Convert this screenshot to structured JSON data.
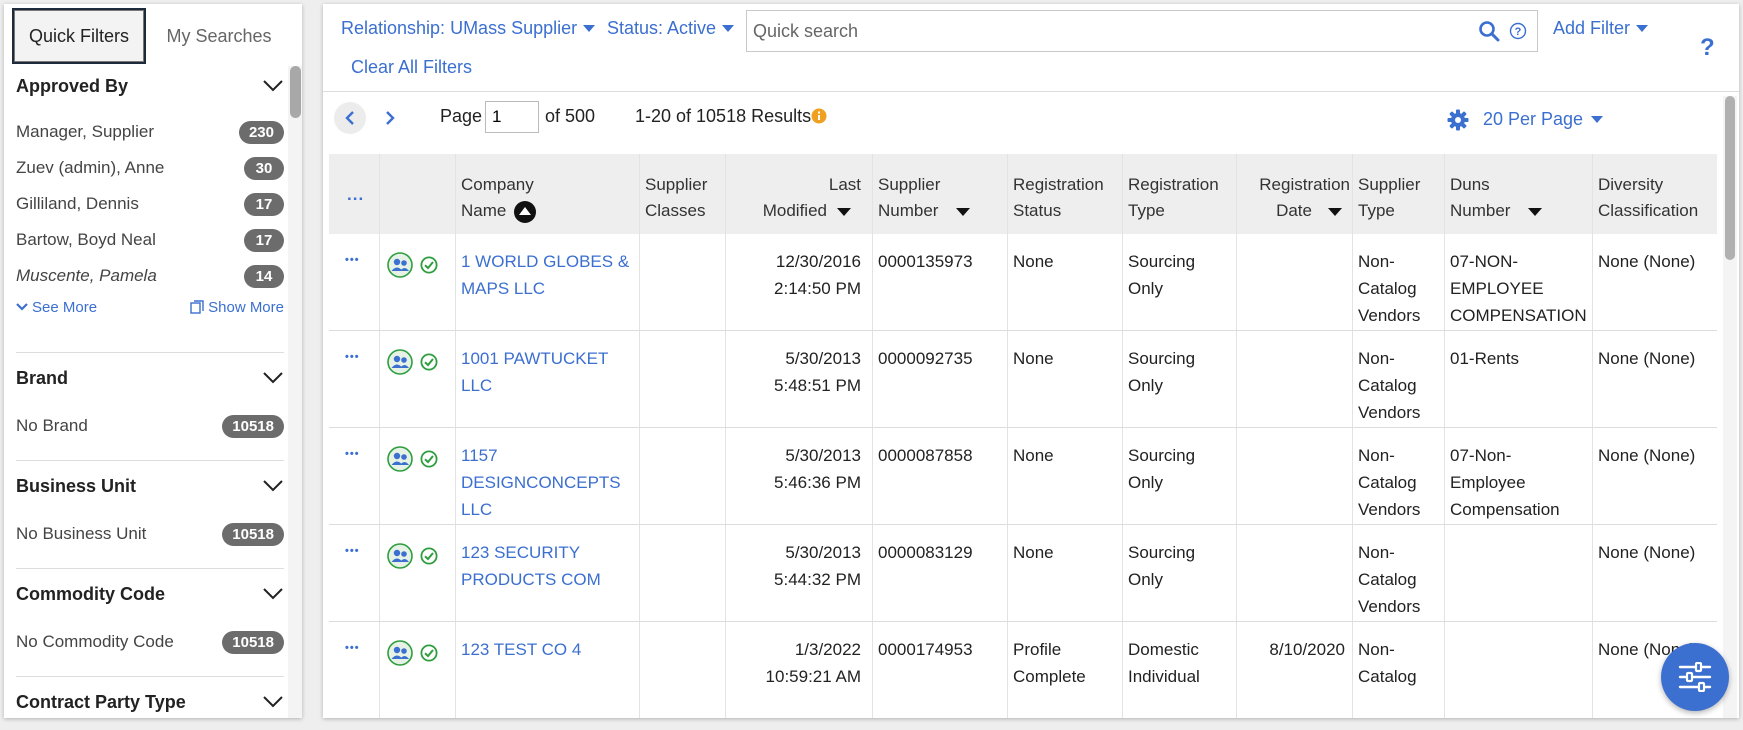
{
  "left_panel": {
    "tabs": [
      {
        "label": "Quick Filters",
        "active": true
      },
      {
        "label": "My Searches",
        "active": false
      }
    ],
    "see_more": "See More",
    "show_more": "Show More",
    "sections": [
      {
        "title": "Approved By",
        "items": [
          {
            "label": "Manager, Supplier",
            "count": "230",
            "italic": false
          },
          {
            "label": "Zuev (admin), Anne",
            "count": "30",
            "italic": false
          },
          {
            "label": "Gilliland, Dennis",
            "count": "17",
            "italic": false
          },
          {
            "label": "Bartow, Boyd Neal",
            "count": "17",
            "italic": false
          },
          {
            "label": "Muscente, Pamela",
            "count": "14",
            "italic": true
          }
        ]
      },
      {
        "title": "Brand",
        "items": [
          {
            "label": "No Brand",
            "count": "10518"
          }
        ]
      },
      {
        "title": "Business Unit",
        "items": [
          {
            "label": "No Business Unit",
            "count": "10518"
          }
        ]
      },
      {
        "title": "Commodity Code",
        "items": [
          {
            "label": "No Commodity Code",
            "count": "10518"
          }
        ]
      },
      {
        "title": "Contract Party Type",
        "items": []
      }
    ]
  },
  "filters": {
    "relationship": "Relationship: UMass Supplier",
    "status": "Status: Active",
    "search_placeholder": "Quick search",
    "add_filter": "Add Filter",
    "clear_all": "Clear All Filters",
    "help": "?"
  },
  "pager": {
    "page_label": "Page",
    "page_value": "1",
    "of_label": "of 500",
    "results": "1-20 of 10518 Results",
    "per_page": "20 Per Page"
  },
  "table": {
    "headers": {
      "actions": "...",
      "company_name": [
        "Company",
        "Name"
      ],
      "supplier_classes": [
        "Supplier",
        "Classes"
      ],
      "last_modified": [
        "Last",
        "Modified"
      ],
      "supplier_number": [
        "Supplier",
        "Number"
      ],
      "registration_status": [
        "Registration",
        "Status"
      ],
      "registration_type": [
        "Registration",
        "Type"
      ],
      "registration_date": [
        "Registration",
        "Date"
      ],
      "supplier_type": [
        "Supplier",
        "Type"
      ],
      "duns_number": [
        "Duns",
        "Number"
      ],
      "diversity": [
        "Diversity",
        "Classification"
      ]
    },
    "rows": [
      {
        "company": [
          "1 WORLD GLOBES &",
          "MAPS LLC"
        ],
        "modified": [
          "12/30/2016",
          "2:14:50 PM"
        ],
        "number": "0000135973",
        "reg_status": [
          "None"
        ],
        "reg_type": [
          "Sourcing",
          "Only"
        ],
        "reg_date": "",
        "supplier_type": [
          "Non-",
          "Catalog",
          "Vendors"
        ],
        "duns": [
          "07-NON-",
          "EMPLOYEE",
          "COMPENSATION"
        ],
        "diversity": "None (None)"
      },
      {
        "company": [
          "1001 PAWTUCKET",
          "LLC"
        ],
        "modified": [
          "5/30/2013",
          "5:48:51 PM"
        ],
        "number": "0000092735",
        "reg_status": [
          "None"
        ],
        "reg_type": [
          "Sourcing",
          "Only"
        ],
        "reg_date": "",
        "supplier_type": [
          "Non-",
          "Catalog",
          "Vendors"
        ],
        "duns": [
          "01-Rents"
        ],
        "diversity": "None (None)"
      },
      {
        "company": [
          "1157",
          "DESIGNCONCEPTS",
          "LLC"
        ],
        "modified": [
          "5/30/2013",
          "5:46:36 PM"
        ],
        "number": "0000087858",
        "reg_status": [
          "None"
        ],
        "reg_type": [
          "Sourcing",
          "Only"
        ],
        "reg_date": "",
        "supplier_type": [
          "Non-",
          "Catalog",
          "Vendors"
        ],
        "duns": [
          "07-Non-",
          "Employee",
          "Compensation"
        ],
        "diversity": "None (None)"
      },
      {
        "company": [
          "123 SECURITY",
          "PRODUCTS COM"
        ],
        "modified": [
          "5/30/2013",
          "5:44:32 PM"
        ],
        "number": "0000083129",
        "reg_status": [
          "None"
        ],
        "reg_type": [
          "Sourcing",
          "Only"
        ],
        "reg_date": "",
        "supplier_type": [
          "Non-",
          "Catalog",
          "Vendors"
        ],
        "duns": [],
        "diversity": "None (None)"
      },
      {
        "company": [
          "123 TEST CO 4"
        ],
        "modified": [
          "1/3/2022",
          "10:59:21 AM"
        ],
        "number": "0000174953",
        "reg_status": [
          "Profile",
          "Complete"
        ],
        "reg_type": [
          "Domestic",
          "Individual"
        ],
        "reg_date": "8/10/2020",
        "supplier_type": [
          "Non-",
          "Catalog"
        ],
        "duns": [],
        "diversity": "None (None)"
      }
    ]
  },
  "colors": {
    "link": "#3b6fd0",
    "badge": "#6c6c6c",
    "header_bg": "#eeeeee",
    "check_green": "#2e9e3e"
  },
  "icons": [
    "chevron-down-icon",
    "search-icon",
    "help-circle-icon",
    "info-icon",
    "gear-icon",
    "chevron-left-icon",
    "chevron-right-icon",
    "supplier-people-icon",
    "check-circle-icon",
    "sliders-icon",
    "copy-icon"
  ]
}
